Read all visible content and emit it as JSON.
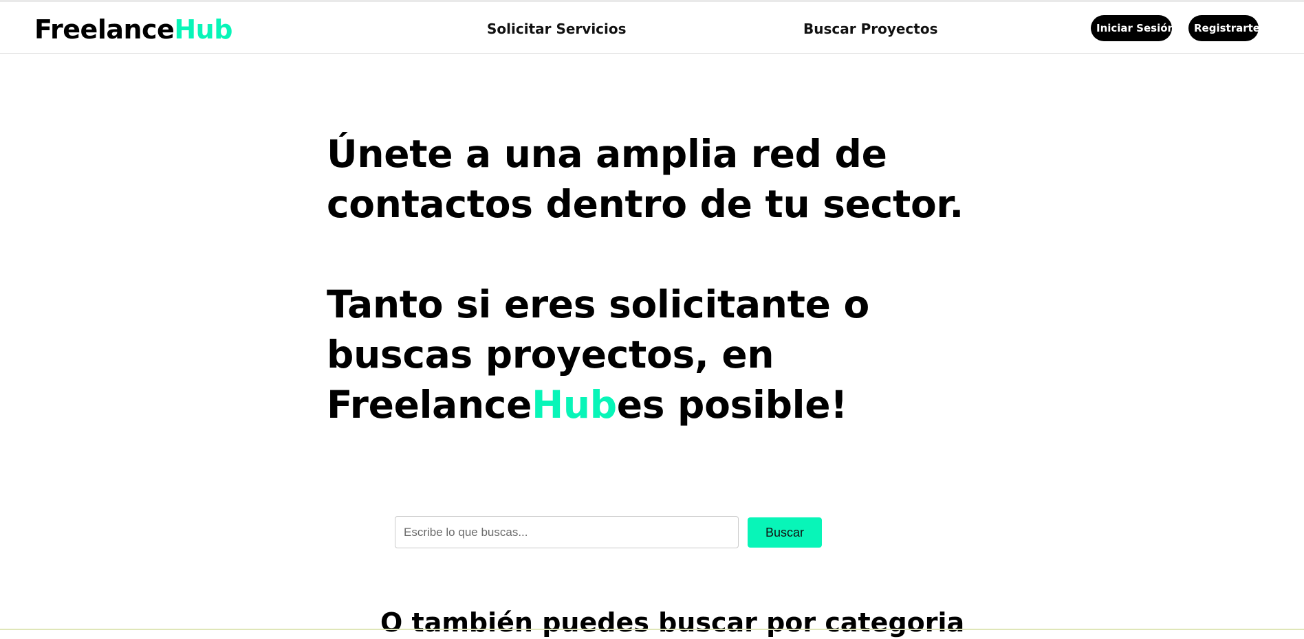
{
  "brand": {
    "name_part1": "Freelance",
    "name_part2": "Hub",
    "accent_color": "#08f5b8"
  },
  "nav": {
    "links": [
      {
        "label": "Solicitar Servicios"
      },
      {
        "label": "Buscar Proyectos"
      }
    ],
    "login_label": "Iniciar Sesión",
    "register_label": "Registrarte"
  },
  "hero": {
    "line1": "Únete a una amplia red de",
    "line2": "contactos dentro de tu sector.",
    "line3": "Tanto si eres solicitante o",
    "line4": "buscas proyectos, en",
    "line5_part1": "Freelance",
    "line5_part2": "Hub",
    "line5_part3": "es posible!"
  },
  "search": {
    "placeholder": "Escribe lo que buscas...",
    "value": "",
    "button_label": "Buscar"
  },
  "categories": {
    "heading": "O también puedes buscar por categoria"
  }
}
